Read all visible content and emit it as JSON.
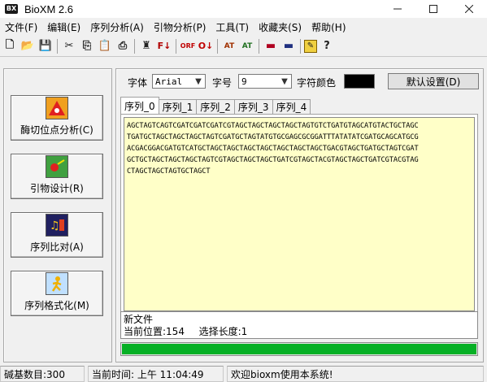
{
  "window": {
    "title": "BioXM 2.6",
    "logo_text": "BX"
  },
  "menu": [
    "文件(F)",
    "编辑(E)",
    "序列分析(A)",
    "引物分析(P)",
    "工具(T)",
    "收藏夹(S)",
    "帮助(H)"
  ],
  "toolbar": {
    "new": "🗋",
    "open": "📂",
    "save": "💾",
    "cut": "✂",
    "copy": "⎘",
    "paste": "📋",
    "print": "⎙",
    "find": "♜",
    "replace": "F↓",
    "orf": "ORF",
    "complement": "O↓",
    "translate_1": "AT",
    "translate_2": "AT",
    "flag_1": "▬",
    "flag_2": "▬",
    "notes": "✎",
    "help": "?"
  },
  "left_buttons": {
    "enzyme": "酶切位点分析(C)",
    "primer": "引物设计(R)",
    "align": "序列比对(A)",
    "format": "序列格式化(M)"
  },
  "font_settings": {
    "font_label": "字体",
    "font_value": "Arial",
    "size_label": "字号",
    "size_value": "9",
    "color_label": "字符颜色",
    "text_color": "#000000",
    "default_button": "默认设置(D)"
  },
  "tabs": [
    "序列_0",
    "序列_1",
    "序列_2",
    "序列_3",
    "序列_4"
  ],
  "sequence_lines": [
    "AGCTAGTCAGTCGATCGATCGATCGTAGCTAGCTAGCTAGCTAGTGTCTGATGTAGCATGTACTGCTAGC",
    "TGATGCTAGCTAGCTAGCTAGTCGATGCTAGTATGTGCGAGCGCGGATTTATATATCGATGCAGCATGCG",
    "ACGACGGACGATGTCATGCTAGCTAGCTAGCTAGCTAGCTAGCTAGCTGACGTAGCTGATGCTAGTCGAT",
    "GCTGCTAGCTAGCTAGCTAGTCGTAGCTAGCTAGCTGATCGTAGCTACGTAGCTAGCTGATCGTACGTAG",
    "CTAGCTAGCTAGTGCTAGCT"
  ],
  "status": {
    "file_name": "新文件",
    "position_label": "当前位置:",
    "position_value": "154",
    "selection_label": "选择长度:",
    "selection_value": "1"
  },
  "progress": {
    "fraction": 1.0,
    "color": "#06b025"
  },
  "statusbar": {
    "bases": "碱基数目:300",
    "time": "当前时间: 上午 11:04:49",
    "welcome": "欢迎bioxm使用本系统!"
  }
}
